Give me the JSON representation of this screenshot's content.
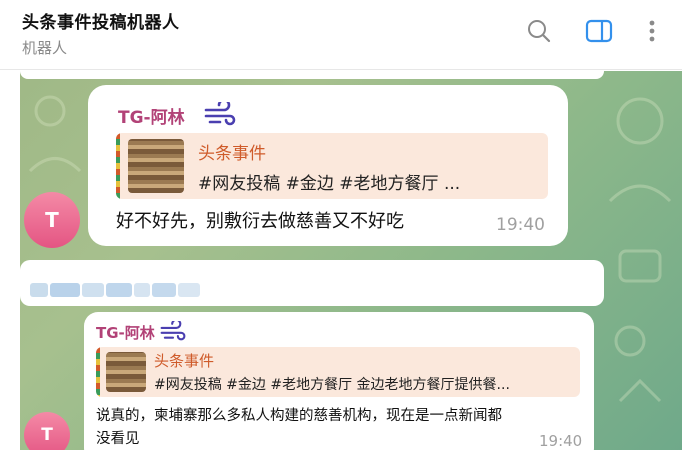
{
  "header": {
    "title": "头条事件投稿机器人",
    "subtitle": "机器人",
    "icons": [
      "search-icon",
      "sidebar-toggle-icon",
      "more-vertical-icon"
    ],
    "accent": "#3390ec"
  },
  "messages": [
    {
      "sender": "TG-阿林",
      "reply_title": "头条事件",
      "reply_text": "#网友投稿 #金边 #老地方餐厅 ...",
      "text": "好不好先，别敷衍去做慈善又不好吃",
      "time": "19:40",
      "avatar": "T"
    },
    {
      "sender": "TG-阿林",
      "reply_title": "头条事件",
      "reply_text": "#网友投稿 #金边 #老地方餐厅 金边老地方餐厅提供餐...",
      "text_line1": "说真的，柬埔寨那么多私人构建的慈善机构，现在是一点新闻都",
      "text_line2": "没看见",
      "time": "19:40",
      "avatar": "T"
    }
  ],
  "colors": {
    "sender": "#b24277",
    "reply_title": "#cf5b2a",
    "reply_bg": "#fbe8dc",
    "avatar": "#e45583"
  }
}
